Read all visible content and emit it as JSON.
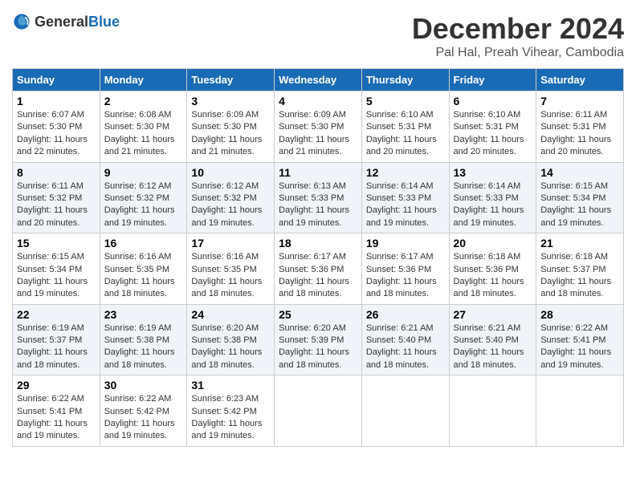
{
  "header": {
    "logo_general": "General",
    "logo_blue": "Blue",
    "month_title": "December 2024",
    "subtitle": "Pal Hal, Preah Vihear, Cambodia"
  },
  "columns": [
    "Sunday",
    "Monday",
    "Tuesday",
    "Wednesday",
    "Thursday",
    "Friday",
    "Saturday"
  ],
  "weeks": [
    [
      {
        "day": "1",
        "lines": [
          "Sunrise: 6:07 AM",
          "Sunset: 5:30 PM",
          "Daylight: 11 hours",
          "and 22 minutes."
        ]
      },
      {
        "day": "2",
        "lines": [
          "Sunrise: 6:08 AM",
          "Sunset: 5:30 PM",
          "Daylight: 11 hours",
          "and 21 minutes."
        ]
      },
      {
        "day": "3",
        "lines": [
          "Sunrise: 6:09 AM",
          "Sunset: 5:30 PM",
          "Daylight: 11 hours",
          "and 21 minutes."
        ]
      },
      {
        "day": "4",
        "lines": [
          "Sunrise: 6:09 AM",
          "Sunset: 5:30 PM",
          "Daylight: 11 hours",
          "and 21 minutes."
        ]
      },
      {
        "day": "5",
        "lines": [
          "Sunrise: 6:10 AM",
          "Sunset: 5:31 PM",
          "Daylight: 11 hours",
          "and 20 minutes."
        ]
      },
      {
        "day": "6",
        "lines": [
          "Sunrise: 6:10 AM",
          "Sunset: 5:31 PM",
          "Daylight: 11 hours",
          "and 20 minutes."
        ]
      },
      {
        "day": "7",
        "lines": [
          "Sunrise: 6:11 AM",
          "Sunset: 5:31 PM",
          "Daylight: 11 hours",
          "and 20 minutes."
        ]
      }
    ],
    [
      {
        "day": "8",
        "lines": [
          "Sunrise: 6:11 AM",
          "Sunset: 5:32 PM",
          "Daylight: 11 hours",
          "and 20 minutes."
        ]
      },
      {
        "day": "9",
        "lines": [
          "Sunrise: 6:12 AM",
          "Sunset: 5:32 PM",
          "Daylight: 11 hours",
          "and 19 minutes."
        ]
      },
      {
        "day": "10",
        "lines": [
          "Sunrise: 6:12 AM",
          "Sunset: 5:32 PM",
          "Daylight: 11 hours",
          "and 19 minutes."
        ]
      },
      {
        "day": "11",
        "lines": [
          "Sunrise: 6:13 AM",
          "Sunset: 5:33 PM",
          "Daylight: 11 hours",
          "and 19 minutes."
        ]
      },
      {
        "day": "12",
        "lines": [
          "Sunrise: 6:14 AM",
          "Sunset: 5:33 PM",
          "Daylight: 11 hours",
          "and 19 minutes."
        ]
      },
      {
        "day": "13",
        "lines": [
          "Sunrise: 6:14 AM",
          "Sunset: 5:33 PM",
          "Daylight: 11 hours",
          "and 19 minutes."
        ]
      },
      {
        "day": "14",
        "lines": [
          "Sunrise: 6:15 AM",
          "Sunset: 5:34 PM",
          "Daylight: 11 hours",
          "and 19 minutes."
        ]
      }
    ],
    [
      {
        "day": "15",
        "lines": [
          "Sunrise: 6:15 AM",
          "Sunset: 5:34 PM",
          "Daylight: 11 hours",
          "and 19 minutes."
        ]
      },
      {
        "day": "16",
        "lines": [
          "Sunrise: 6:16 AM",
          "Sunset: 5:35 PM",
          "Daylight: 11 hours",
          "and 18 minutes."
        ]
      },
      {
        "day": "17",
        "lines": [
          "Sunrise: 6:16 AM",
          "Sunset: 5:35 PM",
          "Daylight: 11 hours",
          "and 18 minutes."
        ]
      },
      {
        "day": "18",
        "lines": [
          "Sunrise: 6:17 AM",
          "Sunset: 5:36 PM",
          "Daylight: 11 hours",
          "and 18 minutes."
        ]
      },
      {
        "day": "19",
        "lines": [
          "Sunrise: 6:17 AM",
          "Sunset: 5:36 PM",
          "Daylight: 11 hours",
          "and 18 minutes."
        ]
      },
      {
        "day": "20",
        "lines": [
          "Sunrise: 6:18 AM",
          "Sunset: 5:36 PM",
          "Daylight: 11 hours",
          "and 18 minutes."
        ]
      },
      {
        "day": "21",
        "lines": [
          "Sunrise: 6:18 AM",
          "Sunset: 5:37 PM",
          "Daylight: 11 hours",
          "and 18 minutes."
        ]
      }
    ],
    [
      {
        "day": "22",
        "lines": [
          "Sunrise: 6:19 AM",
          "Sunset: 5:37 PM",
          "Daylight: 11 hours",
          "and 18 minutes."
        ]
      },
      {
        "day": "23",
        "lines": [
          "Sunrise: 6:19 AM",
          "Sunset: 5:38 PM",
          "Daylight: 11 hours",
          "and 18 minutes."
        ]
      },
      {
        "day": "24",
        "lines": [
          "Sunrise: 6:20 AM",
          "Sunset: 5:38 PM",
          "Daylight: 11 hours",
          "and 18 minutes."
        ]
      },
      {
        "day": "25",
        "lines": [
          "Sunrise: 6:20 AM",
          "Sunset: 5:39 PM",
          "Daylight: 11 hours",
          "and 18 minutes."
        ]
      },
      {
        "day": "26",
        "lines": [
          "Sunrise: 6:21 AM",
          "Sunset: 5:40 PM",
          "Daylight: 11 hours",
          "and 18 minutes."
        ]
      },
      {
        "day": "27",
        "lines": [
          "Sunrise: 6:21 AM",
          "Sunset: 5:40 PM",
          "Daylight: 11 hours",
          "and 18 minutes."
        ]
      },
      {
        "day": "28",
        "lines": [
          "Sunrise: 6:22 AM",
          "Sunset: 5:41 PM",
          "Daylight: 11 hours",
          "and 19 minutes."
        ]
      }
    ],
    [
      {
        "day": "29",
        "lines": [
          "Sunrise: 6:22 AM",
          "Sunset: 5:41 PM",
          "Daylight: 11 hours",
          "and 19 minutes."
        ]
      },
      {
        "day": "30",
        "lines": [
          "Sunrise: 6:22 AM",
          "Sunset: 5:42 PM",
          "Daylight: 11 hours",
          "and 19 minutes."
        ]
      },
      {
        "day": "31",
        "lines": [
          "Sunrise: 6:23 AM",
          "Sunset: 5:42 PM",
          "Daylight: 11 hours",
          "and 19 minutes."
        ]
      },
      null,
      null,
      null,
      null
    ]
  ]
}
